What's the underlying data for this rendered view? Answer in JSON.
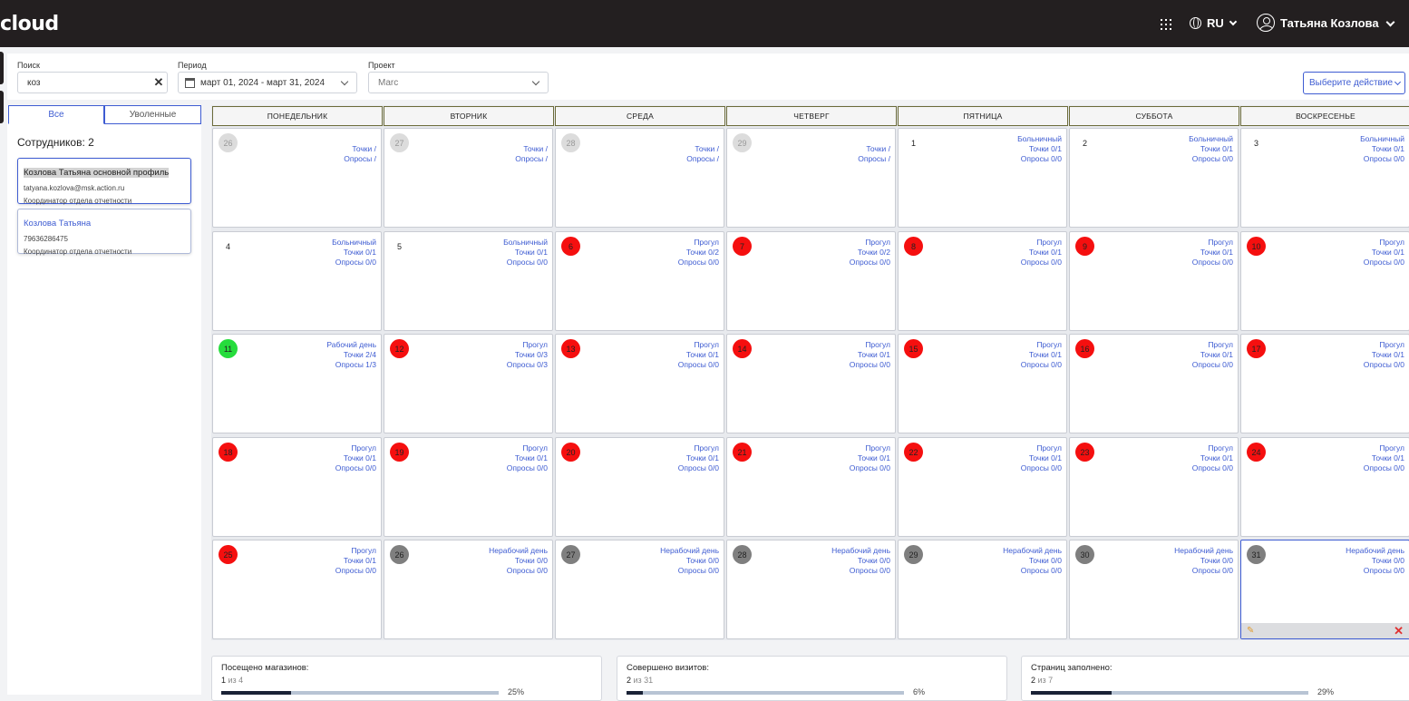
{
  "header": {
    "logo": "cloud",
    "lang": "RU",
    "user_name": "Татьяна Козлова"
  },
  "filters": {
    "search_label": "Поиск",
    "search_value": "коз",
    "period_label": "Период",
    "period_value": "март 01, 2024 - март 31, 2024",
    "project_label": "Проект",
    "project_value": "Marс",
    "action_label": "Выберите действие"
  },
  "left": {
    "tab_all": "Все",
    "tab_fired": "Уволенные",
    "count_label": "Сотрудников: 2",
    "employees": [
      {
        "name": "Козлова Татьяна основной профиль",
        "sub": "tatyana.kozlova@msk.action.ru",
        "role": "Координатор отдела отчетности"
      },
      {
        "name": "Козлова Татьяна",
        "sub": "79636286475",
        "role": "Координатор отдела отчетности"
      }
    ]
  },
  "calendar": {
    "weekdays": [
      "ПОНЕДЕЛЬНИК",
      "ВТОРНИК",
      "СРЕДА",
      "ЧЕТВЕРГ",
      "ПЯТНИЦА",
      "СУББОТА",
      "ВОСКРЕСЕНЬЕ"
    ],
    "days": [
      {
        "n": "26",
        "s": "prev",
        "l1": "",
        "l2": "Точки /",
        "l3": "Опросы /"
      },
      {
        "n": "27",
        "s": "prev",
        "l1": "",
        "l2": "Точки /",
        "l3": "Опросы /"
      },
      {
        "n": "28",
        "s": "prev",
        "l1": "",
        "l2": "Точки /",
        "l3": "Опросы /"
      },
      {
        "n": "29",
        "s": "prev",
        "l1": "",
        "l2": "Точки /",
        "l3": "Опросы /"
      },
      {
        "n": "1",
        "s": "plain",
        "l1": "Больничный",
        "l2": "Точки 0/1",
        "l3": "Опросы 0/0"
      },
      {
        "n": "2",
        "s": "plain",
        "l1": "Больничный",
        "l2": "Точки 0/1",
        "l3": "Опросы 0/0"
      },
      {
        "n": "3",
        "s": "plain",
        "l1": "Больничный",
        "l2": "Точки 0/1",
        "l3": "Опросы 0/0"
      },
      {
        "n": "4",
        "s": "plain",
        "l1": "Больничный",
        "l2": "Точки 0/1",
        "l3": "Опросы 0/0"
      },
      {
        "n": "5",
        "s": "plain",
        "l1": "Больничный",
        "l2": "Точки 0/1",
        "l3": "Опросы 0/0"
      },
      {
        "n": "6",
        "s": "red",
        "l1": "Прогул",
        "l2": "Точки 0/2",
        "l3": "Опросы 0/0"
      },
      {
        "n": "7",
        "s": "red",
        "l1": "Прогул",
        "l2": "Точки 0/2",
        "l3": "Опросы 0/0"
      },
      {
        "n": "8",
        "s": "red",
        "l1": "Прогул",
        "l2": "Точки 0/1",
        "l3": "Опросы 0/0"
      },
      {
        "n": "9",
        "s": "red",
        "l1": "Прогул",
        "l2": "Точки 0/1",
        "l3": "Опросы 0/0"
      },
      {
        "n": "10",
        "s": "red",
        "l1": "Прогул",
        "l2": "Точки 0/1",
        "l3": "Опросы 0/0"
      },
      {
        "n": "11",
        "s": "green",
        "l1": "Рабочий день",
        "l2": "Точки 2/4",
        "l3": "Опросы 1/3"
      },
      {
        "n": "12",
        "s": "red",
        "l1": "Прогул",
        "l2": "Точки 0/3",
        "l3": "Опросы 0/3"
      },
      {
        "n": "13",
        "s": "red",
        "l1": "Прогул",
        "l2": "Точки 0/1",
        "l3": "Опросы 0/0"
      },
      {
        "n": "14",
        "s": "red",
        "l1": "Прогул",
        "l2": "Точки 0/1",
        "l3": "Опросы 0/0"
      },
      {
        "n": "15",
        "s": "red",
        "l1": "Прогул",
        "l2": "Точки 0/1",
        "l3": "Опросы 0/0"
      },
      {
        "n": "16",
        "s": "red",
        "l1": "Прогул",
        "l2": "Точки 0/1",
        "l3": "Опросы 0/0"
      },
      {
        "n": "17",
        "s": "red",
        "l1": "Прогул",
        "l2": "Точки 0/1",
        "l3": "Опросы 0/0"
      },
      {
        "n": "18",
        "s": "red",
        "l1": "Прогул",
        "l2": "Точки 0/1",
        "l3": "Опросы 0/0"
      },
      {
        "n": "19",
        "s": "red",
        "l1": "Прогул",
        "l2": "Точки 0/1",
        "l3": "Опросы 0/0"
      },
      {
        "n": "20",
        "s": "red",
        "l1": "Прогул",
        "l2": "Точки 0/1",
        "l3": "Опросы 0/0"
      },
      {
        "n": "21",
        "s": "red",
        "l1": "Прогул",
        "l2": "Точки 0/1",
        "l3": "Опросы 0/0"
      },
      {
        "n": "22",
        "s": "red",
        "l1": "Прогул",
        "l2": "Точки 0/1",
        "l3": "Опросы 0/0"
      },
      {
        "n": "23",
        "s": "red",
        "l1": "Прогул",
        "l2": "Точки 0/1",
        "l3": "Опросы 0/0"
      },
      {
        "n": "24",
        "s": "red",
        "l1": "Прогул",
        "l2": "Точки 0/1",
        "l3": "Опросы 0/0"
      },
      {
        "n": "25",
        "s": "red",
        "l1": "Прогул",
        "l2": "Точки 0/1",
        "l3": "Опросы 0/0"
      },
      {
        "n": "26",
        "s": "grey",
        "l1": "Нерабочий день",
        "l2": "Точки 0/0",
        "l3": "Опросы 0/0"
      },
      {
        "n": "27",
        "s": "grey",
        "l1": "Нерабочий день",
        "l2": "Точки 0/0",
        "l3": "Опросы 0/0"
      },
      {
        "n": "28",
        "s": "grey",
        "l1": "Нерабочий день",
        "l2": "Точки 0/0",
        "l3": "Опросы 0/0"
      },
      {
        "n": "29",
        "s": "grey",
        "l1": "Нерабочий день",
        "l2": "Точки 0/0",
        "l3": "Опросы 0/0"
      },
      {
        "n": "30",
        "s": "grey",
        "l1": "Нерабочий день",
        "l2": "Точки 0/0",
        "l3": "Опросы 0/0"
      },
      {
        "n": "31",
        "s": "grey",
        "l1": "Нерабочий день",
        "l2": "Точки 0/0",
        "l3": "Опросы 0/0"
      }
    ]
  },
  "stats": [
    {
      "title": "Посещено магазинов:",
      "num": "1",
      "rest": " из 4",
      "pct": "25%",
      "fill": 0.25
    },
    {
      "title": "Совершено визитов:",
      "num": "2",
      "rest": " из 31",
      "pct": "6%",
      "fill": 0.06
    },
    {
      "title": "Страниц заполнено:",
      "num": "2",
      "rest": " из 7",
      "pct": "29%",
      "fill": 0.29
    }
  ]
}
